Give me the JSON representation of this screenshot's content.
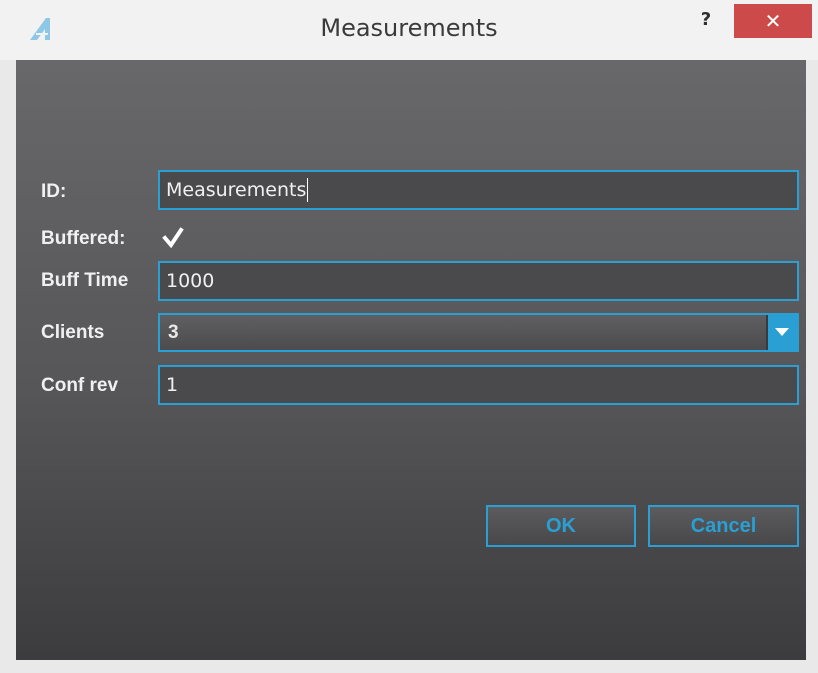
{
  "window": {
    "title": "Measurements",
    "help_label": "?",
    "close_label": "✕",
    "icon": "app-logo-icon"
  },
  "form": {
    "id": {
      "label": "ID:",
      "value": "Measurements"
    },
    "buffered": {
      "label": "Buffered:",
      "checked": true
    },
    "buff_time": {
      "label": "Buff Time",
      "value": "1000"
    },
    "clients": {
      "label": "Clients",
      "value": "3"
    },
    "conf_rev": {
      "label": "Conf rev",
      "value": "1"
    }
  },
  "buttons": {
    "ok": "OK",
    "cancel": "Cancel"
  },
  "colors": {
    "accent": "#2a9fd3",
    "close": "#cc4a4a",
    "panel": "#565658"
  }
}
